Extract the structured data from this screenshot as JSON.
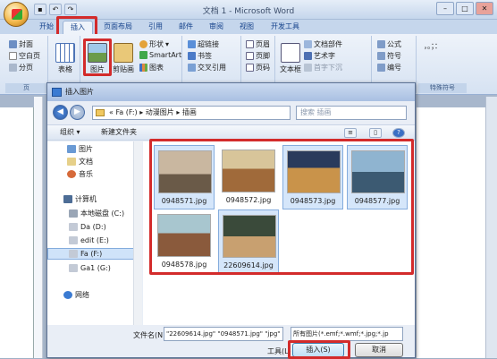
{
  "app": {
    "title": "文档 1 - Microsoft Word"
  },
  "quick_access": [
    "save-icon",
    "undo-icon",
    "redo-icon"
  ],
  "tabs": [
    {
      "label": "开始",
      "active": false
    },
    {
      "label": "插入",
      "active": true
    },
    {
      "label": "页面布局",
      "active": false
    },
    {
      "label": "引用",
      "active": false
    },
    {
      "label": "邮件",
      "active": false
    },
    {
      "label": "审阅",
      "active": false
    },
    {
      "label": "视图",
      "active": false
    },
    {
      "label": "开发工具",
      "active": false
    }
  ],
  "ribbon": {
    "pages": {
      "items": [
        "封面",
        "空白页",
        "分页"
      ],
      "label": "页"
    },
    "tables": {
      "table": "表格"
    },
    "illustrations": {
      "picture": "图片",
      "clipart": "剪贴画",
      "shapes": "形状",
      "smartart": "SmartArt",
      "chart": "图表"
    },
    "links": {
      "hyperlink": "超链接",
      "bookmark": "书签",
      "crossref": "交叉引用"
    },
    "header_footer": {
      "header": "页眉",
      "footer": "页脚",
      "page_number": "页码"
    },
    "text": {
      "textbox": "文本框",
      "quickparts": "文档部件",
      "wordart": "艺术字",
      "dropcap": "首字下沉"
    },
    "symbols": {
      "equation": "公式",
      "symbol": "符号",
      "number": "编号",
      "label": "特殊符号"
    }
  },
  "dialog": {
    "title": "插入图片",
    "path": [
      "Fa (F:)",
      "动漫图片",
      "插画"
    ],
    "search_placeholder": "搜索 插画",
    "toolbar": {
      "organize": "组织 ▾",
      "new_folder": "新建文件夹"
    },
    "nav": [
      {
        "label": "图片",
        "icon": "pictures-icon",
        "indent": 1
      },
      {
        "label": "文档",
        "icon": "documents-icon",
        "indent": 1
      },
      {
        "label": "音乐",
        "icon": "music-icon",
        "indent": 1
      },
      {
        "label": "计算机",
        "icon": "computer-icon",
        "indent": 0
      },
      {
        "label": "本地磁盘 (C:)",
        "icon": "drive-icon",
        "indent": 1
      },
      {
        "label": "Da (D:)",
        "icon": "drive-icon",
        "indent": 1
      },
      {
        "label": "edit (E:)",
        "icon": "drive-icon",
        "indent": 1
      },
      {
        "label": "Fa (F:)",
        "icon": "drive-icon",
        "indent": 1,
        "selected": true
      },
      {
        "label": "Ga1 (G:)",
        "icon": "drive-icon",
        "indent": 1
      },
      {
        "label": "网络",
        "icon": "network-icon",
        "indent": 0
      }
    ],
    "files": [
      {
        "name": "0948571.jpg",
        "sky": "#c9b7a0",
        "ground": "#6a5a48"
      },
      {
        "name": "0948572.jpg",
        "sky": "#d8c59a",
        "ground": "#a06a3a"
      },
      {
        "name": "0948573.jpg",
        "sky": "#2a3b5c",
        "ground": "#c9934a"
      },
      {
        "name": "0948577.jpg",
        "sky": "#8fb4d0",
        "ground": "#3c5a72"
      },
      {
        "name": "0948578.jpg",
        "sky": "#a8c6cf",
        "ground": "#8a5a3c"
      },
      {
        "name": "22609614.jpg",
        "sky": "#3a4a3a",
        "ground": "#c8a070",
        "selected": true
      }
    ],
    "filename_label": "文件名(N):",
    "filename_value": "\"22609614.jpg\" \"0948571.jpg\" \"jpg\" \"",
    "filetype_value": "所有图片(*.emf;*.wmf;*.jpg;*.jp",
    "tools": "工具(L)",
    "insert": "插入(S)",
    "cancel": "取消"
  },
  "colors": {
    "highlight": "#d32b2b",
    "ribbon_bg": "#d6e2f2",
    "selection": "#d5e6fa"
  }
}
